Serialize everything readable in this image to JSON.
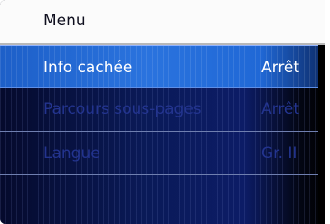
{
  "menu": {
    "title": "Menu",
    "items": [
      {
        "label": "Info cachée",
        "value": "Arrêt"
      },
      {
        "label": "Parcours sous-pages",
        "value": "Arrêt"
      },
      {
        "label": "Langue",
        "value": "Gr. II"
      }
    ]
  }
}
